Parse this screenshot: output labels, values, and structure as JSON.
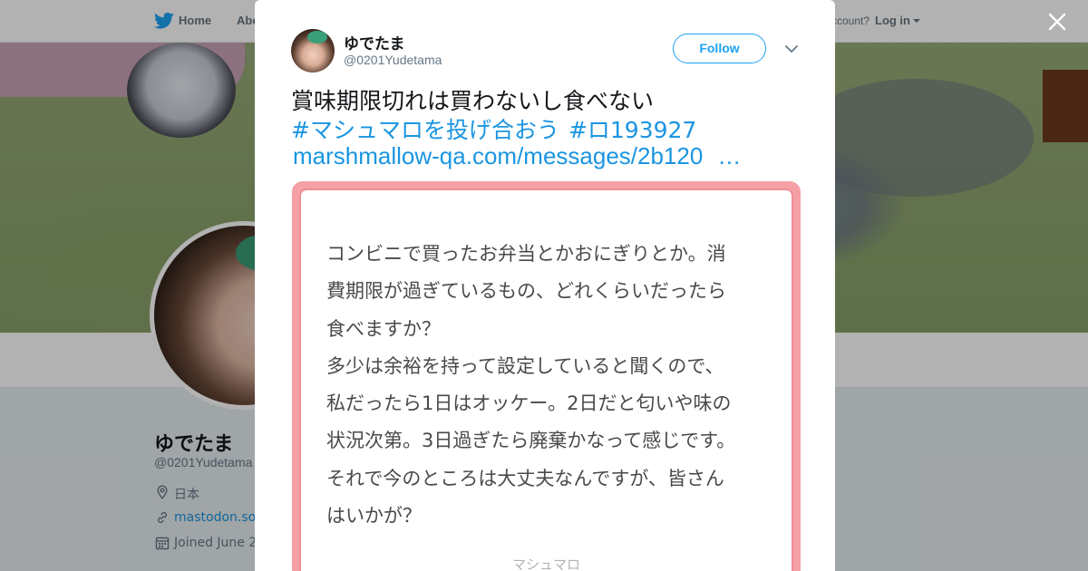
{
  "nav": {
    "home_label": "Home",
    "about_label": "Abo",
    "account_prompt": "ccount?",
    "login_label": "Log in"
  },
  "profile": {
    "name": "ゆでたま",
    "handle": "@0201Yudetama",
    "location": "日本",
    "url": "mastodon.soc",
    "joined": "Joined June 2"
  },
  "tweet": {
    "author_name": "ゆでたま",
    "author_handle": "@0201Yudetama",
    "follow_label": "Follow",
    "text": "賞味期限切れは買わないし食べない",
    "hashtags": [
      "#マシュマロを投げ合おう",
      "#ロ193927"
    ],
    "link": "marshmallow-qa.com/messages/2b120",
    "link_ellipsis": "…"
  },
  "card": {
    "question_lines": [
      "コンビニで買ったお弁当とかおにぎりとか。消",
      "費期限が過ぎているもの、どれくらいだったら",
      "食べますか？",
      "多少は余裕を持って設定していると聞くので、",
      "私だったら1日はオッケー。2日だと匂いや味の",
      "状況次第。3日過ぎたら廃棄かなって感じです。",
      "それで今のところは大丈夫なんですが、皆さん",
      "はいかが？"
    ],
    "footer": "マシュマロ"
  },
  "icons": {
    "nav_logo": "twitter-bird-icon",
    "nav_caret": "caret-down-icon",
    "close": "close-icon",
    "tweet_caret": "chevron-down-icon",
    "location": "location-pin-icon",
    "url": "link-icon",
    "joined": "calendar-icon"
  },
  "colors": {
    "brand_blue": "#1da1f2",
    "link_blue": "#1b95e0",
    "card_border_pink": "#f4a0a5",
    "text_dark": "#14171a",
    "text_muted": "#657786"
  }
}
